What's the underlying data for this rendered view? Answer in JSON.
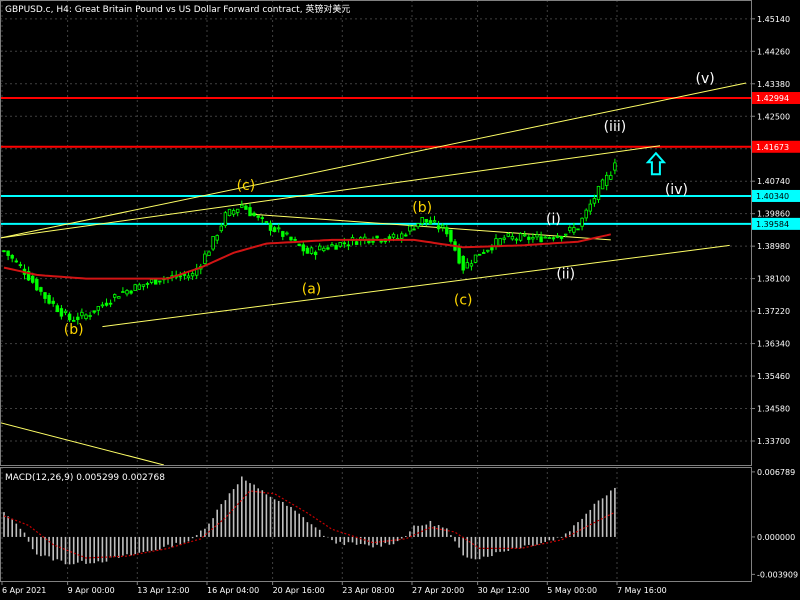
{
  "window": {
    "title": "GBPUSD.c, H4:  Great Britain Pound vs US Dollar Forward contract, 英镑对美元"
  },
  "colors": {
    "background": "#000000",
    "grid": "#404040",
    "candle": "#00ff00",
    "red_lines": "#ff0000",
    "cyan_lines": "#00ffff",
    "trend_lines": "#ffff66",
    "wave_labels_yellow": "#ffd700",
    "wave_labels_white": "#ffffff",
    "moving_average": "#d21414",
    "macd_histogram": "#c0c0c0",
    "macd_signal": "#c80000",
    "text": "#ffffff"
  },
  "chart_data": [
    {
      "type": "candlestick",
      "symbol": "GBPUSD.c",
      "timeframe": "H4",
      "ylim": [
        1.3305,
        1.4565
      ],
      "y_ticks": [
        "1.45140",
        "1.44260",
        "1.43380",
        "1.42500",
        "1.41620",
        "1.40740",
        "1.39860",
        "1.38980",
        "1.38100",
        "1.37220",
        "1.36340",
        "1.35460",
        "1.34580",
        "1.33700"
      ],
      "x_ticks": [
        "6 Apr 2021",
        "9 Apr 00:00",
        "13 Apr 12:00",
        "16 Apr 04:00",
        "20 Apr 16:00",
        "23 Apr 08:00",
        "27 Apr 20:00",
        "30 Apr 12:00",
        "5 May 00:00",
        "7 May 16:00"
      ],
      "bar_count": 150,
      "price_path": [
        [
          0,
          1.3885
        ],
        [
          5,
          1.383
        ],
        [
          10,
          1.376
        ],
        [
          16,
          1.37
        ],
        [
          20,
          1.371
        ],
        [
          28,
          1.377
        ],
        [
          38,
          1.381
        ],
        [
          46,
          1.382
        ],
        [
          50,
          1.389
        ],
        [
          54,
          1.398
        ],
        [
          58,
          1.401
        ],
        [
          62,
          1.397
        ],
        [
          68,
          1.393
        ],
        [
          74,
          1.388
        ],
        [
          80,
          1.39
        ],
        [
          88,
          1.392
        ],
        [
          96,
          1.392
        ],
        [
          102,
          1.397
        ],
        [
          108,
          1.394
        ],
        [
          112,
          1.384
        ],
        [
          116,
          1.388
        ],
        [
          122,
          1.392
        ],
        [
          130,
          1.392
        ],
        [
          136,
          1.393
        ],
        [
          140,
          1.395
        ],
        [
          144,
          1.403
        ],
        [
          148,
          1.41
        ],
        [
          150,
          1.4167
        ]
      ],
      "moving_average": [
        [
          0,
          1.384
        ],
        [
          8,
          1.382
        ],
        [
          20,
          1.381
        ],
        [
          40,
          1.381
        ],
        [
          48,
          1.384
        ],
        [
          56,
          1.388
        ],
        [
          64,
          1.3905
        ],
        [
          80,
          1.3915
        ],
        [
          100,
          1.3915
        ],
        [
          112,
          1.3895
        ],
        [
          126,
          1.39
        ],
        [
          140,
          1.391
        ],
        [
          148,
          1.393
        ]
      ],
      "horizontal_levels": [
        {
          "price": 1.42994,
          "label": "1.42994",
          "color": "red"
        },
        {
          "price": 1.41673,
          "label": "1.41673",
          "color": "red"
        },
        {
          "price": 1.4034,
          "label": "1.40340",
          "color": "cyan"
        },
        {
          "price": 1.39584,
          "label": "1.39584",
          "color": "cyan"
        }
      ],
      "trend_lines": [
        {
          "from": [
            -1,
            1.392
          ],
          "to": [
            181,
            1.434
          ]
        },
        {
          "from": [
            -1,
            1.392
          ],
          "to": [
            160,
            1.417
          ]
        },
        {
          "from": [
            24,
            1.368
          ],
          "to": [
            177,
            1.39
          ]
        },
        {
          "from": [
            60,
            1.3985
          ],
          "to": [
            148,
            1.3915
          ]
        },
        {
          "from": [
            -1,
            1.342
          ],
          "to": [
            39,
            1.3305
          ]
        }
      ],
      "annotations": [
        {
          "text": "(b)",
          "at": [
            17,
            1.366
          ],
          "color": "yellow"
        },
        {
          "text": "(c)",
          "at": [
            59,
            1.405
          ],
          "color": "yellow"
        },
        {
          "text": "(a)",
          "at": [
            75,
            1.377
          ],
          "color": "yellow"
        },
        {
          "text": "(b)",
          "at": [
            102,
            1.399
          ],
          "color": "yellow"
        },
        {
          "text": "(c)",
          "at": [
            112,
            1.374
          ],
          "color": "yellow"
        },
        {
          "text": "(i)",
          "at": [
            134,
            1.396
          ],
          "color": "white"
        },
        {
          "text": "(ii)",
          "at": [
            137,
            1.381
          ],
          "color": "white"
        },
        {
          "text": "(iii)",
          "at": [
            149,
            1.421
          ],
          "color": "white"
        },
        {
          "text": "(iv)",
          "at": [
            164,
            1.404
          ],
          "color": "white"
        },
        {
          "text": "(v)",
          "at": [
            171,
            1.434
          ],
          "color": "white"
        }
      ],
      "arrow": {
        "at": [
          159,
          1.412
        ],
        "direction": "up",
        "color": "cyan"
      }
    },
    {
      "type": "bar",
      "name": "MACD",
      "label": "MACD(12,26,9) 0.005299 0.002768",
      "macd": 0.005299,
      "signal": 0.002768,
      "ylim": [
        -0.0046,
        0.0073
      ],
      "y_ticks": [
        "0.006789",
        "0.000000",
        "-0.003909"
      ],
      "histogram_path": [
        [
          0,
          0.0025
        ],
        [
          4,
          0.001
        ],
        [
          8,
          -0.0018
        ],
        [
          16,
          -0.0028
        ],
        [
          24,
          -0.0025
        ],
        [
          32,
          -0.0018
        ],
        [
          40,
          -0.001
        ],
        [
          46,
          -0.0003
        ],
        [
          50,
          0.0015
        ],
        [
          54,
          0.004
        ],
        [
          58,
          0.0062
        ],
        [
          62,
          0.005
        ],
        [
          70,
          0.003
        ],
        [
          76,
          0.001
        ],
        [
          80,
          -0.0005
        ],
        [
          90,
          -0.001
        ],
        [
          96,
          -0.0005
        ],
        [
          100,
          0.001
        ],
        [
          104,
          0.0015
        ],
        [
          108,
          0.0008
        ],
        [
          112,
          -0.002
        ],
        [
          116,
          -0.0022
        ],
        [
          124,
          -0.0012
        ],
        [
          132,
          -0.0005
        ],
        [
          136,
          0.0
        ],
        [
          140,
          0.0015
        ],
        [
          144,
          0.0035
        ],
        [
          150,
          0.0055
        ]
      ],
      "signal_path": [
        [
          0,
          0.0022
        ],
        [
          6,
          0.0012
        ],
        [
          12,
          -0.0008
        ],
        [
          20,
          -0.0022
        ],
        [
          30,
          -0.002
        ],
        [
          40,
          -0.0012
        ],
        [
          48,
          -0.0002
        ],
        [
          54,
          0.002
        ],
        [
          60,
          0.0048
        ],
        [
          66,
          0.0045
        ],
        [
          74,
          0.0025
        ],
        [
          80,
          0.0008
        ],
        [
          90,
          -0.0006
        ],
        [
          98,
          -0.0002
        ],
        [
          104,
          0.001
        ],
        [
          110,
          0.0005
        ],
        [
          116,
          -0.0012
        ],
        [
          126,
          -0.0012
        ],
        [
          136,
          -0.0003
        ],
        [
          144,
          0.0015
        ],
        [
          150,
          0.0028
        ]
      ]
    }
  ]
}
